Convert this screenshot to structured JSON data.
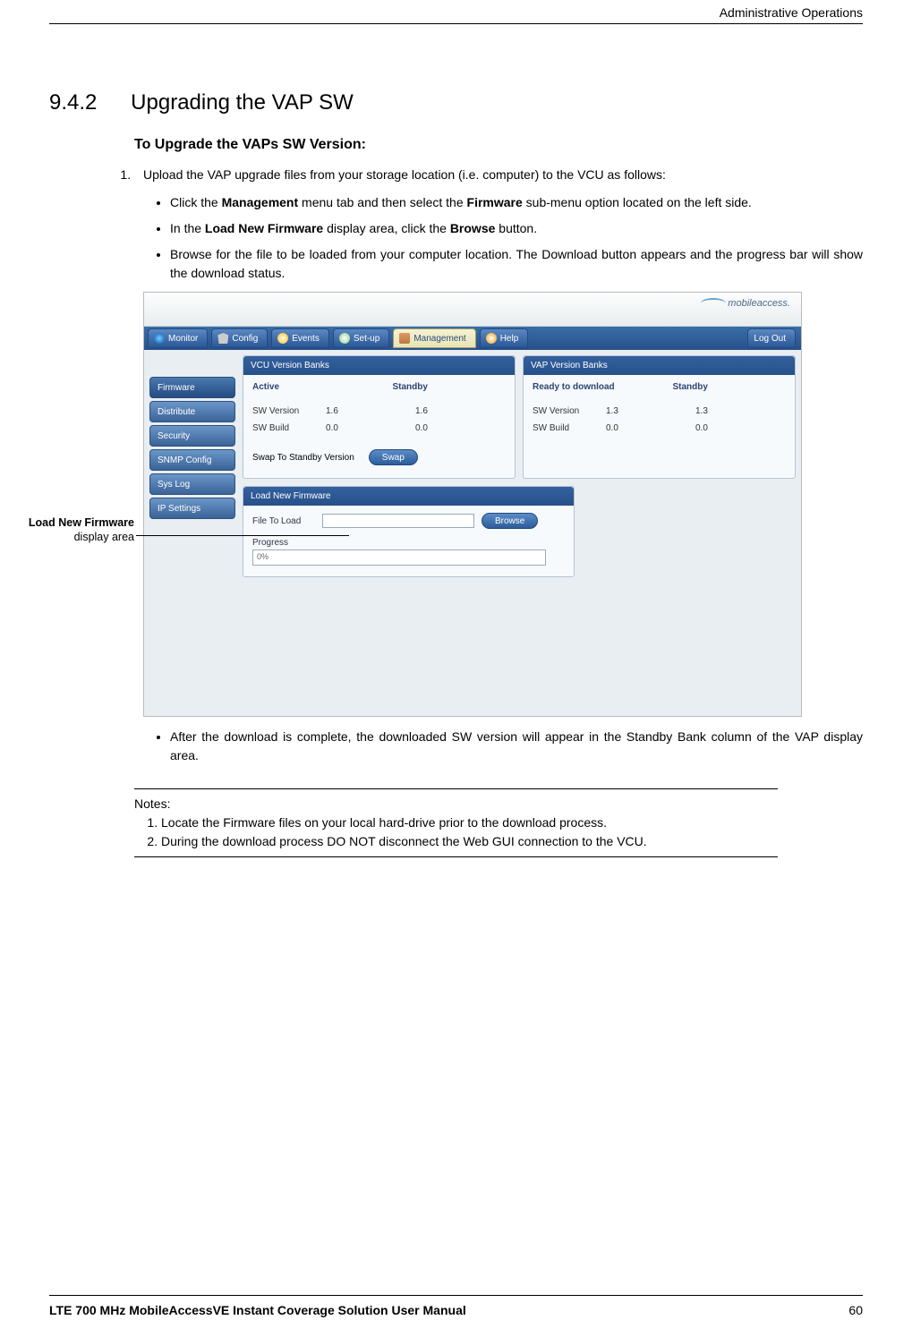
{
  "header": {
    "right": "Administrative Operations"
  },
  "section": {
    "number": "9.4.2",
    "title": "Upgrading the VAP SW",
    "subtitle": "To Upgrade the VAPs SW Version:"
  },
  "step1": {
    "intro": "Upload the VAP upgrade files from your storage location (i.e. computer) to the VCU as follows:",
    "b1_pre": "Click the ",
    "b1_bold1": "Management",
    "b1_mid": " menu tab and then select the ",
    "b1_bold2": "Firmware",
    "b1_post": " sub-menu option located on the left side.",
    "b2_pre": "In the ",
    "b2_bold1": "Load New Firmware",
    "b2_mid": " display area, click the ",
    "b2_bold2": "Browse",
    "b2_post": " button.",
    "b3": "Browse for the file to be loaded from your computer location. The Download button appears and the progress bar will show the download status.",
    "b4": "After the download is complete, the downloaded SW version will appear in the Standby Bank column of the VAP display area."
  },
  "callout": {
    "bold": "Load New Firmware",
    "rest": " display area"
  },
  "screenshot": {
    "logo": "mobileaccess.",
    "menu": {
      "monitor": "Monitor",
      "config": "Config",
      "events": "Events",
      "setup": "Set-up",
      "management": "Management",
      "help": "Help",
      "logout": "Log Out"
    },
    "sidebar": {
      "firmware": "Firmware",
      "distribute": "Distribute",
      "security": "Security",
      "snmp": "SNMP Config",
      "syslog": "Sys Log",
      "ip": "IP Settings"
    },
    "vcu": {
      "title": "VCU Version Banks",
      "col_active": "Active",
      "col_standby": "Standby",
      "row_ver_label": "SW Version",
      "row_ver_active": "1.6",
      "row_ver_standby": "1.6",
      "row_build_label": "SW Build",
      "row_build_active": "0.0",
      "row_build_standby": "0.0",
      "swap_label": "Swap To Standby Version",
      "swap_btn": "Swap"
    },
    "vap": {
      "title": "VAP Version Banks",
      "col_ready": "Ready to download",
      "col_standby": "Standby",
      "row_ver_label": "SW Version",
      "row_ver_ready": "1.3",
      "row_ver_standby": "1.3",
      "row_build_label": "SW Build",
      "row_build_ready": "0.0",
      "row_build_standby": "0.0"
    },
    "load": {
      "title": "Load New Firmware",
      "file_label": "File To Load",
      "browse": "Browse",
      "progress_label": "Progress",
      "progress_value": "0%"
    }
  },
  "notes": {
    "heading": "Notes:",
    "n1": "Locate the Firmware files on your local hard-drive prior to the download process.",
    "n2": "During the download process DO NOT disconnect the Web GUI connection to the VCU."
  },
  "footer": {
    "left": "LTE 700 MHz MobileAccessVE Instant Coverage Solution User Manual",
    "right": "60"
  }
}
